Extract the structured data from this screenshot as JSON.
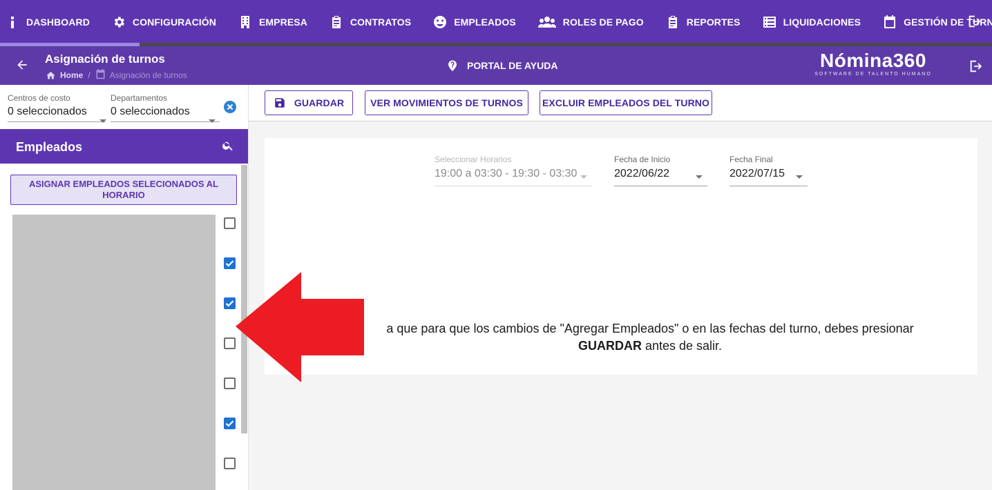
{
  "nav": {
    "items": [
      {
        "label": "DASHBOARD",
        "icon": "info-icon"
      },
      {
        "label": "CONFIGURACIÓN",
        "icon": "gear-icon"
      },
      {
        "label": "EMPRESA",
        "icon": "building-icon"
      },
      {
        "label": "CONTRATOS",
        "icon": "clipboard-icon"
      },
      {
        "label": "EMPLEADOS",
        "icon": "smile-icon"
      },
      {
        "label": "ROLES DE PAGO",
        "icon": "users-icon"
      },
      {
        "label": "REPORTES",
        "icon": "clipboard-icon"
      },
      {
        "label": "LIQUIDACIONES",
        "icon": "list-icon"
      },
      {
        "label": "GESTIÓN DE TURNOS",
        "icon": "calendar-icon"
      }
    ],
    "logout_icon": "logout-icon"
  },
  "header": {
    "title": "Asignación de turnos",
    "breadcrumb": {
      "home": "Home",
      "current": "Asignación de turnos"
    },
    "help_portal": "PORTAL DE AYUDA",
    "brand_name": "Nómina360",
    "brand_tagline": "SOFTWARE DE TALENTO HUMANO"
  },
  "filters": {
    "cost_centers": {
      "label": "Centros de costo",
      "value": "0 seleccionados"
    },
    "departments": {
      "label": "Departamentos",
      "value": "0 seleccionados"
    }
  },
  "employees": {
    "title": "Empleados",
    "assign_button": "ASIGNAR EMPLEADOS SELECIONADOS AL HORARIO",
    "checkboxes": [
      false,
      true,
      true,
      false,
      false,
      true,
      false
    ]
  },
  "toolbar": {
    "save_label": "GUARDAR",
    "movements_label": "VER MOVIMIENTOS DE TURNOS",
    "exclude_label": "EXCLUIR EMPLEADOS DEL TURNO"
  },
  "schedule": {
    "horarios": {
      "label": "Seleccionar Horarios",
      "value": "19:00 a 03:30 - 19:30 - 03:30"
    },
    "start_date": {
      "label": "Fecha de Inicio",
      "value": "2022/06/22"
    },
    "end_date": {
      "label": "Fecha Final",
      "value": "2022/07/15"
    }
  },
  "notice": {
    "line1": "a que para que los cambios de \"Agregar Empleados\" o en las fechas del turno, debes presionar",
    "bold": "GUARDAR",
    "line2_rest": " antes de salir."
  },
  "colors": {
    "primary": "#5e35b1",
    "checkbox": "#1f72d2",
    "arrow": "#ed1c24"
  }
}
